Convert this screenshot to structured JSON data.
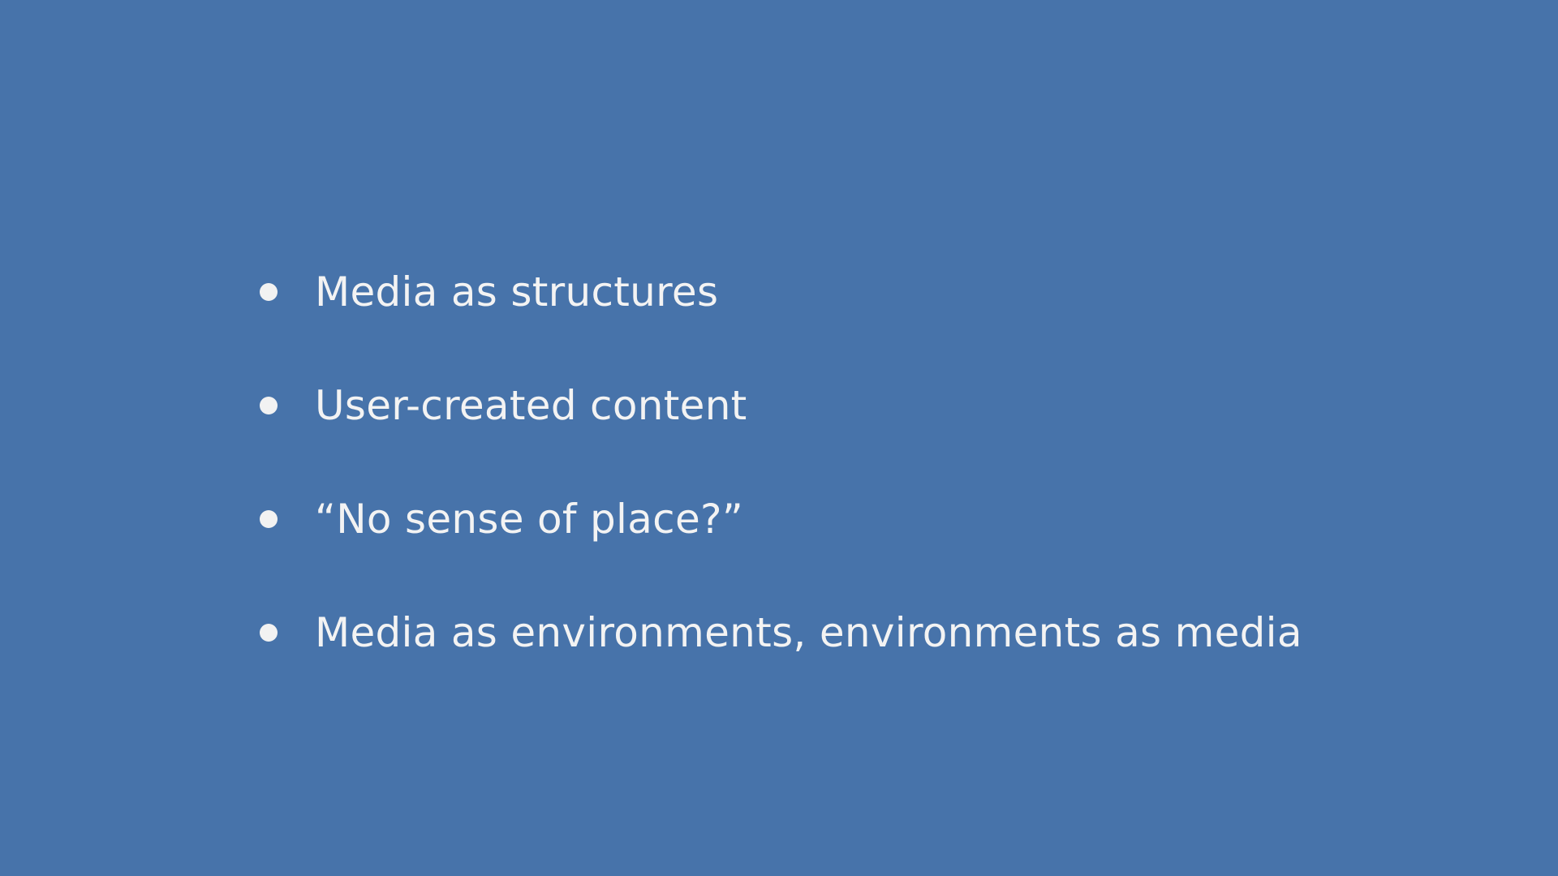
{
  "slide": {
    "background_color": "#4773aa",
    "text_color": "#f3f3f3",
    "bullets": [
      {
        "text": "Media as structures"
      },
      {
        "text": "User-created content"
      },
      {
        "text": "“No sense of place?”"
      },
      {
        "text": "Media as environments, environments as media"
      }
    ]
  }
}
